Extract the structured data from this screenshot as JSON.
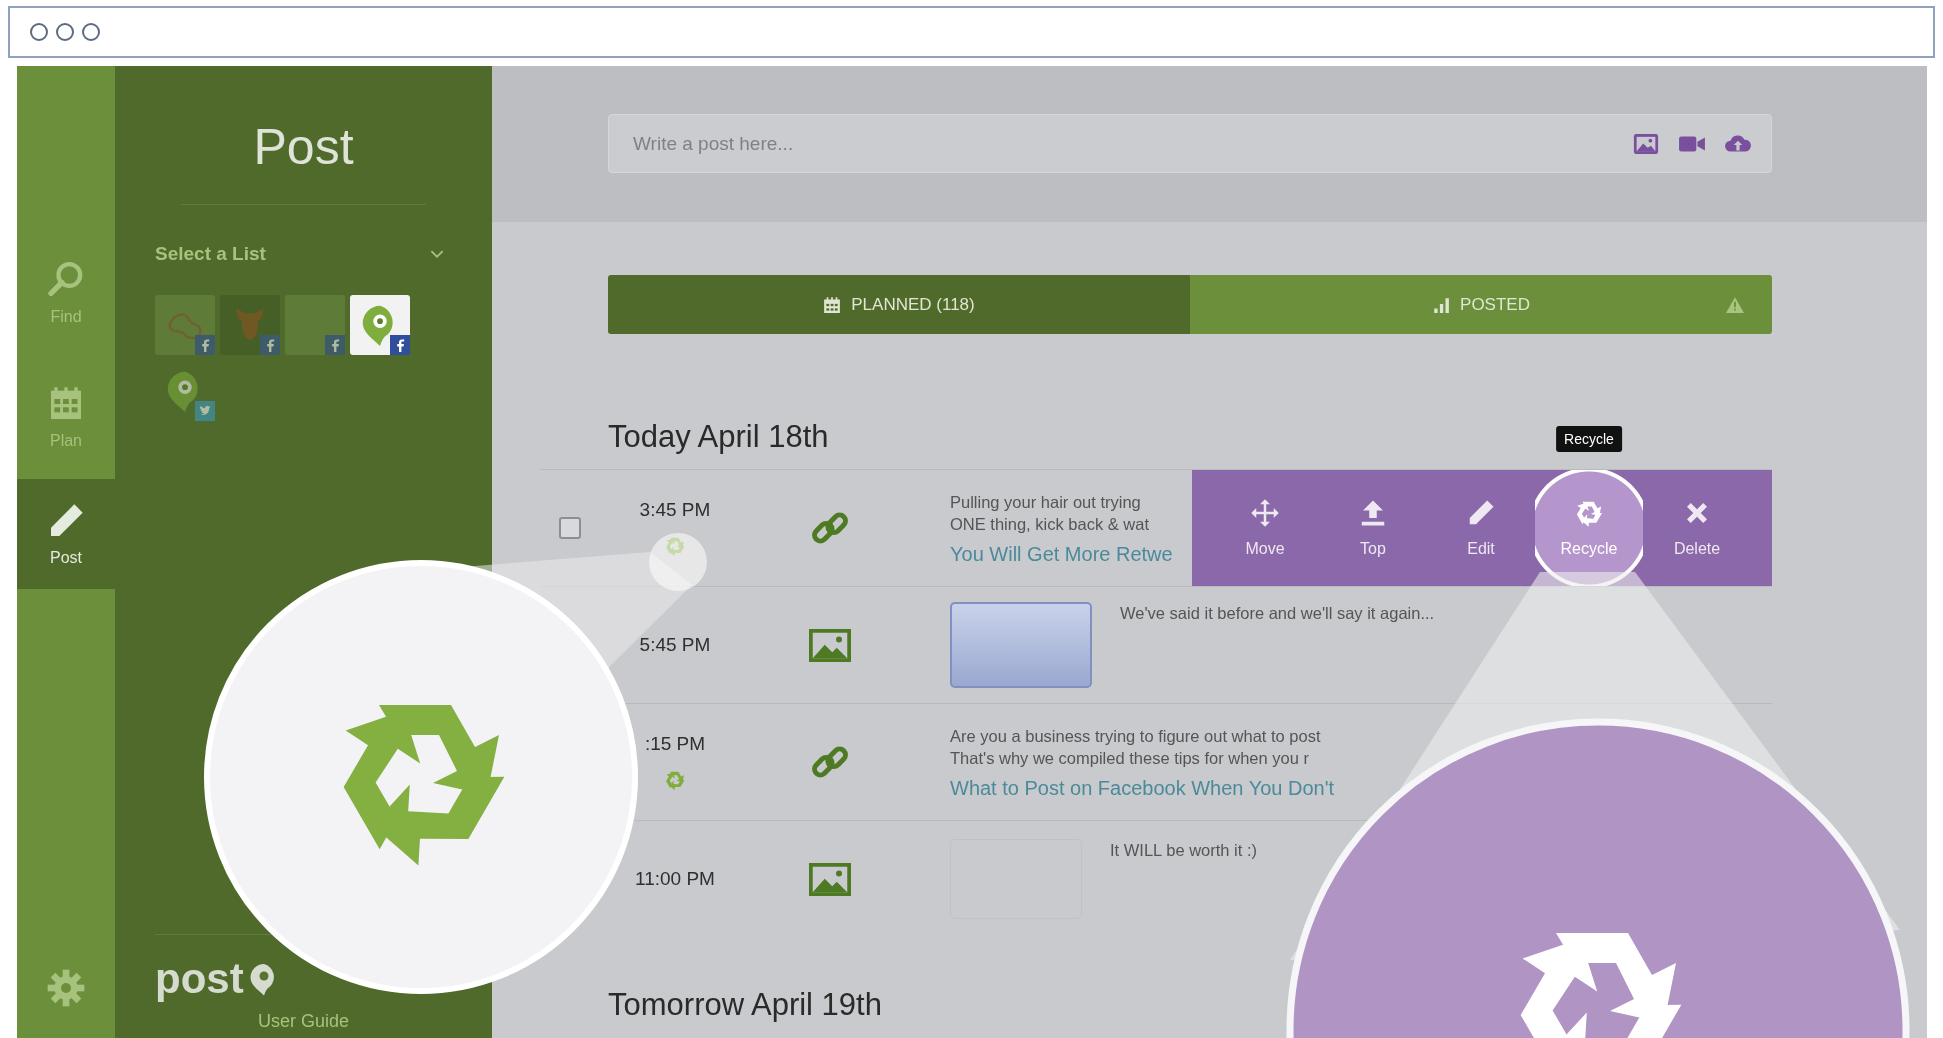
{
  "rail": {
    "items": [
      {
        "kind": "find",
        "label": "Find",
        "selected": false
      },
      {
        "kind": "plan",
        "label": "Plan",
        "selected": false
      },
      {
        "kind": "post",
        "label": "Post",
        "selected": true
      }
    ]
  },
  "sidebar": {
    "title": "Post",
    "list_select": {
      "placeholder": "Select a List"
    },
    "accounts": [
      {
        "kind": "doodle",
        "badge": {
          "kind": "facebook"
        },
        "selected": false
      },
      {
        "kind": "devil",
        "badge": {
          "kind": "facebook"
        },
        "selected": false
      },
      {
        "kind": "blank",
        "badge": {
          "kind": "facebook"
        },
        "selected": false
      },
      {
        "kind": "pin",
        "badge": {
          "kind": "facebook"
        },
        "selected": true
      },
      {
        "kind": "pin",
        "badge": {
          "kind": "twitter"
        },
        "selected": false
      }
    ],
    "logo_text": "post",
    "user_guide": "User Guide"
  },
  "composer": {
    "placeholder": "Write a post here..."
  },
  "tabs": [
    {
      "kind": "planned",
      "label": "PLANNED (118)",
      "selected": true,
      "warning": false
    },
    {
      "kind": "posted",
      "label": "POSTED",
      "selected": false,
      "warning": true
    }
  ],
  "days": [
    {
      "heading": "Today April 18th",
      "posts": [
        {
          "time": "3:45 PM",
          "recycled": true,
          "kind": "link",
          "checkbox": {
            "checked": false
          },
          "lines": [
            "Pulling your hair out trying",
            "ONE thing, kick back & wat"
          ],
          "link_title": "You Will Get More Retwe",
          "action_bar": {
            "tooltip": "Recycle",
            "actions": [
              {
                "kind": "move",
                "label": "Move",
                "highlighted": false
              },
              {
                "kind": "top",
                "label": "Top",
                "highlighted": false
              },
              {
                "kind": "edit",
                "label": "Edit",
                "highlighted": false
              },
              {
                "kind": "recycle",
                "label": "Recycle",
                "highlighted": true
              },
              {
                "kind": "delete",
                "label": "Delete",
                "highlighted": false
              }
            ]
          }
        },
        {
          "time": "5:45 PM",
          "recycled": false,
          "kind": "image",
          "thumbnail": {
            "kind": "sign"
          },
          "caption": "We've said it before and we'll say it again..."
        },
        {
          "time": ":15 PM",
          "recycled": true,
          "kind": "link",
          "lines": [
            "Are you a business trying to figure out what to post",
            "That's why we compiled these tips for when you r"
          ],
          "link_title": "What to Post on Facebook When You Don't"
        },
        {
          "time": "11:00 PM",
          "recycled": false,
          "kind": "image",
          "thumbnail": {
            "kind": "note"
          },
          "caption": "It WILL be worth it :)"
        }
      ]
    },
    {
      "heading": "Tomorrow April 19th"
    }
  ]
}
